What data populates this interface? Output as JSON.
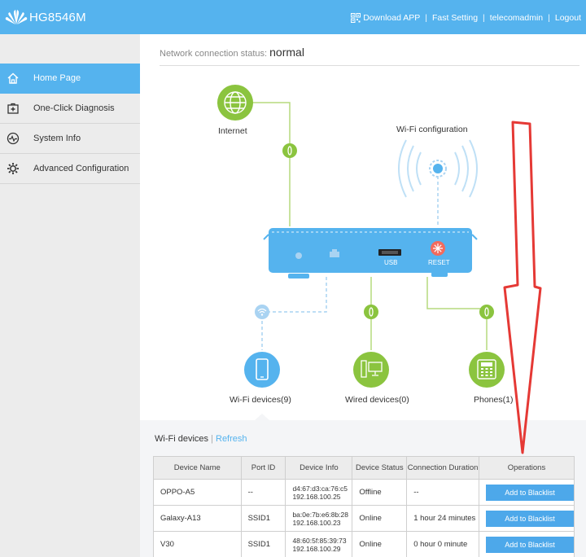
{
  "header": {
    "model": "HG8546M",
    "links": {
      "download": "Download APP",
      "fast": "Fast Setting",
      "user": "telecomadmin",
      "logout": "Logout"
    }
  },
  "sidebar": {
    "items": [
      {
        "label": "Home Page",
        "icon": "home-icon",
        "active": true
      },
      {
        "label": "One-Click Diagnosis",
        "icon": "medical-kit-icon",
        "active": false
      },
      {
        "label": "System Info",
        "icon": "pulse-icon",
        "active": false
      },
      {
        "label": "Advanced Configuration",
        "icon": "gear-icon",
        "active": false
      }
    ]
  },
  "status": {
    "label": "Network connection status:",
    "value": "normal"
  },
  "topology": {
    "internet": "Internet",
    "wifi_config": "Wi-Fi configuration",
    "usb": "USB",
    "reset": "RESET",
    "wifi_devices": "Wi-Fi devices(9)",
    "wired_devices": "Wired devices(0)",
    "phones": "Phones(1)"
  },
  "devices_section": {
    "title": "Wi-Fi devices",
    "sep": "|",
    "refresh": "Refresh"
  },
  "table": {
    "headers": [
      "Device Name",
      "Port ID",
      "Device Info",
      "Device Status",
      "Connection Duration",
      "Operations"
    ],
    "rows": [
      {
        "name": "OPPO-A5",
        "port": "--",
        "mac": "d4:67:d3:ca:76:c5",
        "ip": "192.168.100.25",
        "status": "Offline",
        "duration": "--",
        "action": "Add to Blacklist"
      },
      {
        "name": "Galaxy-A13",
        "port": "SSID1",
        "mac": "ba:0e:7b:e6:8b:28",
        "ip": "192.168.100.23",
        "status": "Online",
        "duration": "1 hour 24 minutes",
        "action": "Add to Blacklist"
      },
      {
        "name": "V30",
        "port": "SSID1",
        "mac": "48:60:5f:85:39:73",
        "ip": "192.168.100.29",
        "status": "Online",
        "duration": "0 hour 0 minute",
        "action": "Add to Blacklist"
      }
    ]
  },
  "colors": {
    "accent": "#55b3ee",
    "green": "#8bc43f",
    "line_green": "#b5da7e",
    "reset": "#f26a5c",
    "arrow": "#e53935"
  }
}
